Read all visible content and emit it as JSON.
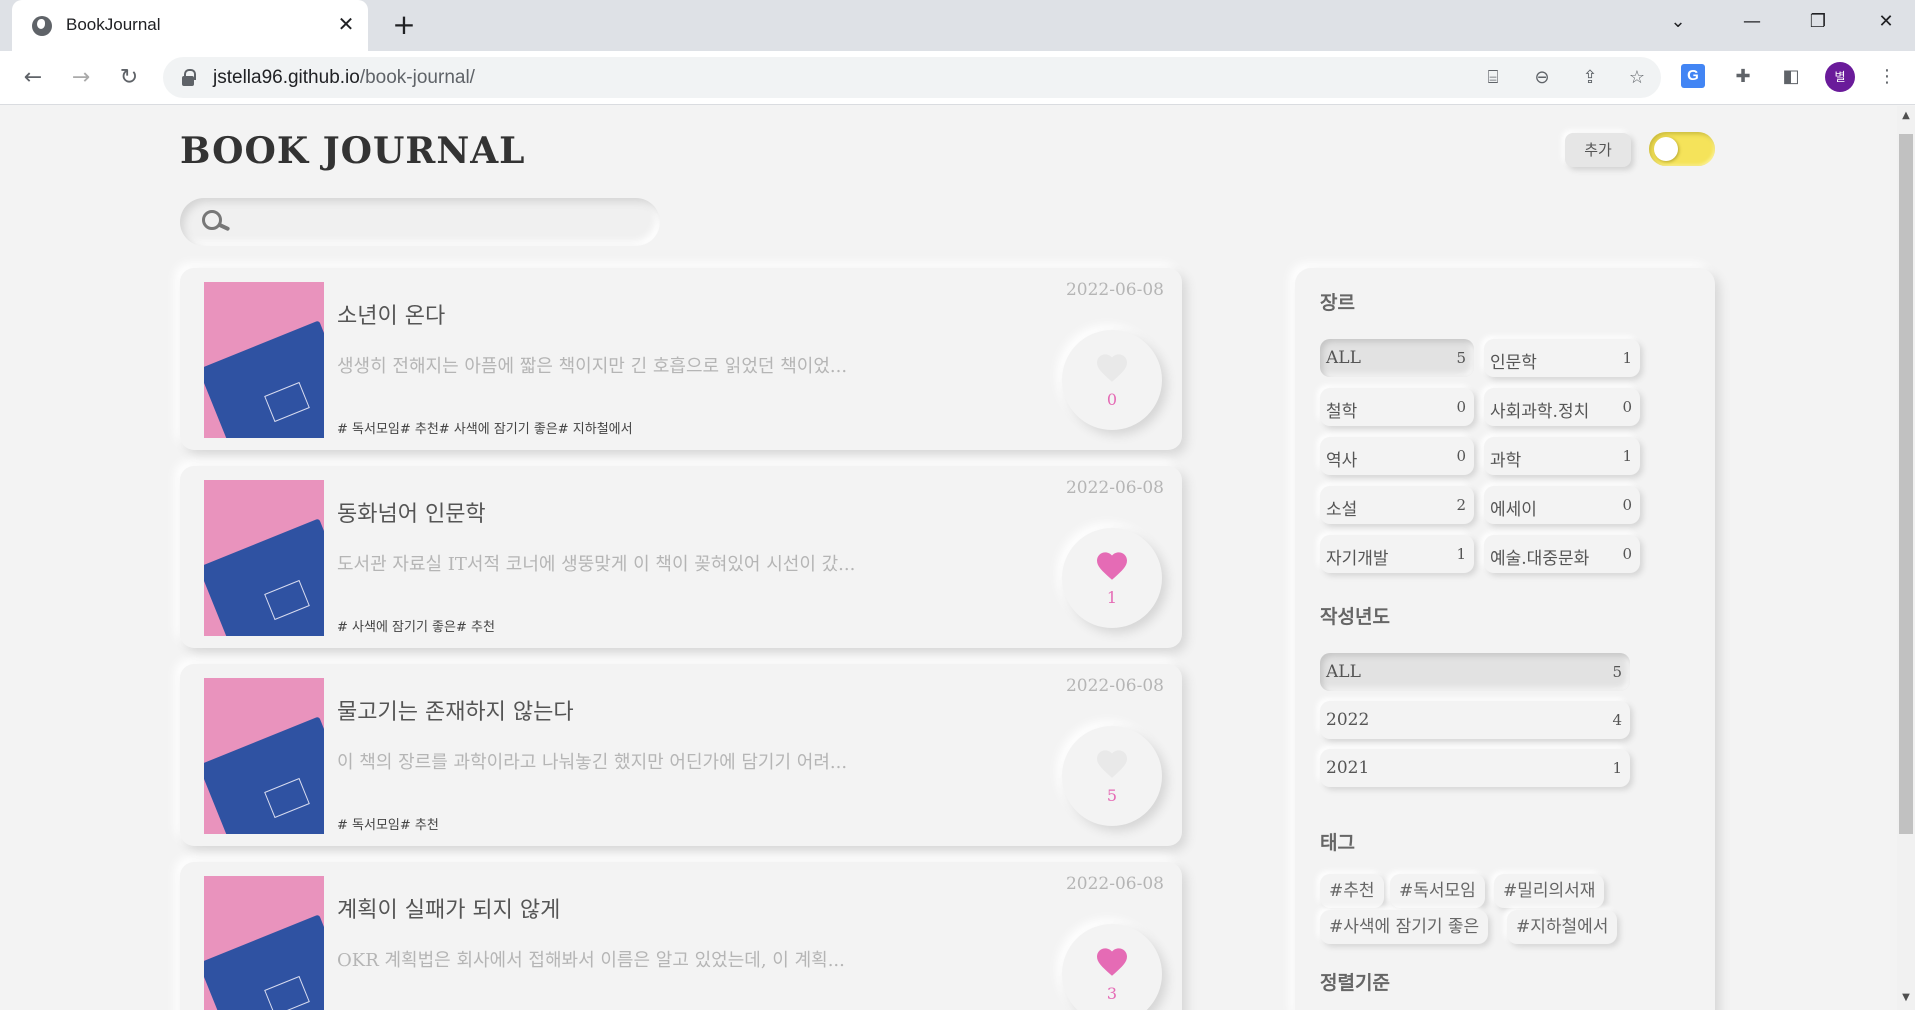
{
  "browser": {
    "tab_title": "BookJournal",
    "close_glyph": "✕",
    "new_tab_glyph": "+",
    "url_host": "jstella96.github.io",
    "url_path": "/book-journal/",
    "profile_initial": "별",
    "translate_glyph": "G"
  },
  "header": {
    "brand": "BOOK JOURNAL",
    "add_label": "추가"
  },
  "search": {
    "placeholder": ""
  },
  "posts": [
    {
      "title": "소년이 온다",
      "excerpt": "생생히 전해지는 아픔에 짧은 책이지만 긴 호흡으로 읽었던 책이었...",
      "tags": "# 독서모임# 추천# 사색에 잠기기 좋은# 지하철에서",
      "date": "2022-06-08",
      "likes": "0",
      "liked": false
    },
    {
      "title": "동화넘어 인문학",
      "excerpt": "도서관 자료실 IT서적 코너에 생뚱맞게 이 책이 꽂혀있어 시선이 갔...",
      "tags": "# 사색에 잠기기 좋은# 추천",
      "date": "2022-06-08",
      "likes": "1",
      "liked": true
    },
    {
      "title": "물고기는 존재하지 않는다",
      "excerpt": "이 책의 장르를 과학이라고 나눠놓긴 했지만 어딘가에 담기기 어려...",
      "tags": "# 독서모임# 추천",
      "date": "2022-06-08",
      "likes": "5",
      "liked": false
    },
    {
      "title": "계획이 실패가 되지 않게",
      "excerpt": "OKR 계획법은 회사에서 접해봐서 이름은 알고 있었는데, 이 계획...",
      "tags": "",
      "date": "2022-06-08",
      "likes": "3",
      "liked": true
    }
  ],
  "sidebar": {
    "genre_title": "장르",
    "genres": [
      {
        "label": "ALL",
        "count": "5",
        "active": true
      },
      {
        "label": "인문학",
        "count": "1",
        "active": false
      },
      {
        "label": "철학",
        "count": "0",
        "active": false
      },
      {
        "label": "사회과학.정치",
        "count": "0",
        "active": false
      },
      {
        "label": "역사",
        "count": "0",
        "active": false
      },
      {
        "label": "과학",
        "count": "1",
        "active": false
      },
      {
        "label": "소설",
        "count": "2",
        "active": false
      },
      {
        "label": "에세이",
        "count": "0",
        "active": false
      },
      {
        "label": "자기개발",
        "count": "1",
        "active": false
      },
      {
        "label": "예술.대중문화",
        "count": "0",
        "active": false
      }
    ],
    "year_title": "작성년도",
    "years": [
      {
        "label": "ALL",
        "count": "5",
        "active": true
      },
      {
        "label": "2022",
        "count": "4",
        "active": false
      },
      {
        "label": "2021",
        "count": "1",
        "active": false
      }
    ],
    "tag_title": "태그",
    "tags": [
      "#추천",
      "#독서모임",
      "#밀리의서재",
      "#사색에 잠기기 좋은",
      "#지하철에서"
    ],
    "sort_title": "정렬기준"
  },
  "colors": {
    "heart_active": "#e56bb5",
    "heart_inactive": "#e9e9e9",
    "toggle": "#f5e35a"
  }
}
